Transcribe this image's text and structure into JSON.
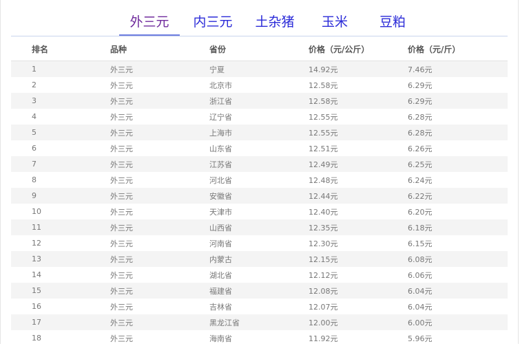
{
  "tabs": [
    {
      "label": "外三元",
      "active": true
    },
    {
      "label": "内三元",
      "active": false
    },
    {
      "label": "土杂猪",
      "active": false
    },
    {
      "label": "玉米",
      "active": false
    },
    {
      "label": "豆粕",
      "active": false
    }
  ],
  "table": {
    "headers": [
      "排名",
      "品种",
      "省份",
      "价格（元/公斤）",
      "价格（元/斤）"
    ],
    "rows": [
      [
        "1",
        "外三元",
        "宁夏",
        "14.92元",
        "7.46元"
      ],
      [
        "2",
        "外三元",
        "北京市",
        "12.58元",
        "6.29元"
      ],
      [
        "3",
        "外三元",
        "浙江省",
        "12.58元",
        "6.29元"
      ],
      [
        "4",
        "外三元",
        "辽宁省",
        "12.55元",
        "6.28元"
      ],
      [
        "5",
        "外三元",
        "上海市",
        "12.55元",
        "6.28元"
      ],
      [
        "6",
        "外三元",
        "山东省",
        "12.51元",
        "6.26元"
      ],
      [
        "7",
        "外三元",
        "江苏省",
        "12.49元",
        "6.25元"
      ],
      [
        "8",
        "外三元",
        "河北省",
        "12.48元",
        "6.24元"
      ],
      [
        "9",
        "外三元",
        "安徽省",
        "12.44元",
        "6.22元"
      ],
      [
        "10",
        "外三元",
        "天津市",
        "12.40元",
        "6.20元"
      ],
      [
        "11",
        "外三元",
        "山西省",
        "12.35元",
        "6.18元"
      ],
      [
        "12",
        "外三元",
        "河南省",
        "12.30元",
        "6.15元"
      ],
      [
        "13",
        "外三元",
        "内蒙古",
        "12.15元",
        "6.08元"
      ],
      [
        "14",
        "外三元",
        "湖北省",
        "12.12元",
        "6.06元"
      ],
      [
        "15",
        "外三元",
        "福建省",
        "12.08元",
        "6.04元"
      ],
      [
        "16",
        "外三元",
        "吉林省",
        "12.07元",
        "6.04元"
      ],
      [
        "17",
        "外三元",
        "黑龙江省",
        "12.00元",
        "6.00元"
      ],
      [
        "18",
        "外三元",
        "海南省",
        "11.92元",
        "5.96元"
      ]
    ]
  },
  "colors": {
    "tab_active": "#6f2a9c",
    "tab_inactive": "#2a2ad8",
    "tab_underline": "#6f7fe0",
    "row_stripe": "#f4f4f4"
  }
}
